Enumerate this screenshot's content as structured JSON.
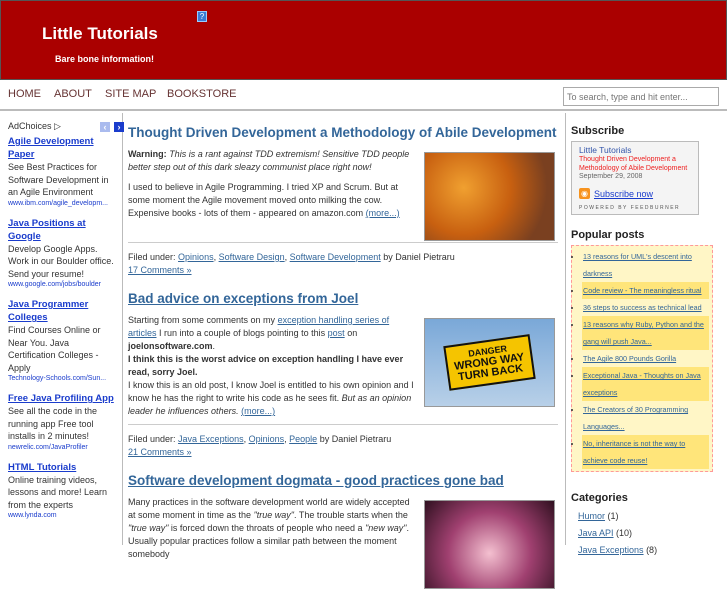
{
  "header": {
    "title": "Little Tutorials",
    "tagline": "Bare bone information!",
    "help_icon": "?"
  },
  "nav": {
    "items": [
      "HOME",
      "ABOUT",
      "SITE MAP",
      "BOOKSTORE"
    ],
    "search_placeholder": "To search, type and hit enter..."
  },
  "ads": {
    "label": "AdChoices ▷",
    "prev": "‹",
    "next": "›",
    "items": [
      {
        "title": "Agile Development Paper",
        "desc": "See Best Practices for Software Development in an Agile Environment",
        "url": "www.ibm.com/agile_developm..."
      },
      {
        "title": "Java Positions at Google",
        "desc": "Develop Google Apps. Work in our Boulder office. Send your resume!",
        "url": "www.google.com/jobs/boulder"
      },
      {
        "title": "Java Programmer Colleges",
        "desc": "Find Courses Online or Near You. Java Certification Colleges - Apply",
        "url": "Technology-Schools.com/Sun..."
      },
      {
        "title": "Free Java Profiling App",
        "desc": "See all the code in the running app Free tool installs in 2 minutes!",
        "url": "newrelic.com/JavaProfiler"
      },
      {
        "title": "HTML Tutorials",
        "desc": "Online training videos, lessons and more! Learn from the experts",
        "url": "www.lynda.com"
      }
    ]
  },
  "posts": [
    {
      "title": "Thought Driven Development a Methodology of Abile Development",
      "warning_label": "Warning:",
      "warning": "This is a rant against TDD extremism! Sensitive TDD people better step out of this dark sleazy communist place right now!",
      "text": "I used to believe in Agile Programming. I tried XP and Scrum. But at some moment the Agile movement moved onto milking the cow. Expensive books - lots of them - appeared on amazon.com",
      "more": "(more...)",
      "filed": "Filed under:",
      "cats": [
        "Opinions",
        "Software Design",
        "Software Development"
      ],
      "by": "by Daniel Pietraru",
      "comments": "17 Comments »"
    },
    {
      "title": "Bad advice on exceptions from Joel",
      "t1": "Starting from some comments on my",
      "l1": "exception handling series of articles",
      "t2": "I run into a couple of blogs pointing to this",
      "l2": "post",
      "t3": "on",
      "b1": "joelonsoftware.com",
      "b2": "I think this is the worst advice on exception handling I have ever read, sorry Joel.",
      "t4": "I know this is an old post, I know Joel is entitled to his own opinion and I know he has the right to write his code as he sees fit.",
      "i1": "But as an opinion leader he influences others.",
      "more": "(more...)",
      "sign": [
        "DANGER",
        "WRONG WAY",
        "TURN BACK"
      ],
      "filed": "Filed under:",
      "cats": [
        "Java Exceptions",
        "Opinions",
        "People"
      ],
      "by": "by Daniel Pietraru",
      "comments": "21 Comments »"
    },
    {
      "title": "Software development dogmata - good practices gone bad",
      "t1": "Many practices in the software development world are widely accepted at some moment in time as the",
      "i1": "\"true way\"",
      "t2": ". The trouble starts when the",
      "i2": "\"true way\"",
      "t3": "is forced down the throats of people who need a",
      "i3": "\"new way\"",
      "t4": ". Usually popular practices follow a similar path between the moment somebody"
    }
  ],
  "sidebar": {
    "subscribe_title": "Subscribe",
    "feed": {
      "title": "Little Tutorials",
      "post": "Thought Driven Development a Methodology of Abile Development",
      "date": "September 29, 2008",
      "subscribe": "Subscribe now",
      "powered": "POWERED BY FEEDBURNER"
    },
    "popular_title": "Popular posts",
    "popular": [
      "13 reasons for UML's descent into darkness",
      "Code review - The meaningless ritual",
      "36 steps to success as technical lead",
      "13 reasons why Ruby, Python and the gang will push Java...",
      "The Agile 800 Pounds Gorilla",
      "Exceptional Java - Thoughts on Java exceptions",
      "The Creators of 30 Programming Languages...",
      "No, inheritance is not the way to achieve code reuse!"
    ],
    "categories_title": "Categories",
    "categories": [
      {
        "name": "Humor",
        "count": "(1)"
      },
      {
        "name": "Java API",
        "count": "(10)"
      },
      {
        "name": "Java Exceptions",
        "count": "(8)"
      }
    ]
  }
}
